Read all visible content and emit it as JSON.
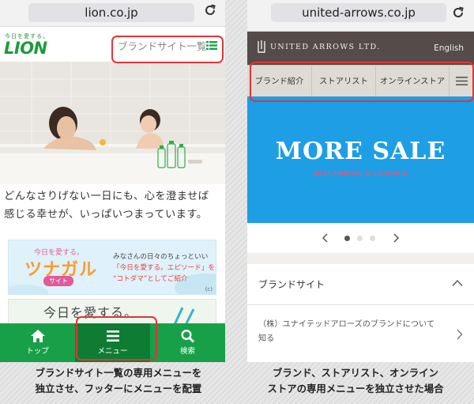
{
  "left": {
    "url": "lion.co.jp",
    "header": {
      "tagline": "今日を愛する。",
      "logo": "LION",
      "brand_menu_label": "ブランドサイト一覧"
    },
    "hero_copy_line1": "どんなさりげない一日にも、心を澄ませば",
    "hero_copy_line2": "感じる幸せが、いっぱいつまっています。",
    "banner1": {
      "small": "今日を愛する。",
      "title": "ツナガル",
      "sub": "サイト",
      "desc_line1": "みなさんの日々のちょっといい",
      "desc_line2": "「今日を愛する。エピソード」を",
      "desc_line3": "“コトダマ”としてご紹介",
      "corner": "(c)"
    },
    "banner2": {
      "text": "今日を愛する。"
    },
    "footer": {
      "top_label": "トップ",
      "menu_label": "メニュー",
      "search_label": "検索"
    },
    "colors": {
      "brand_green": "#18a049",
      "highlight_red": "#e33438"
    }
  },
  "right": {
    "url": "united-arrows.co.jp",
    "header": {
      "logo_text": "UNITED ARROWS LTD.",
      "english": "English"
    },
    "nav": {
      "brand": "ブランド紹介",
      "stores": "ストアリスト",
      "online": "オンラインストア"
    },
    "hero": {
      "title": "MORE SALE",
      "subtitle": "2015 SPRING & SUMMER"
    },
    "carousel": {
      "active_index": 0,
      "count": 3
    },
    "section": {
      "title": "ブランドサイト"
    },
    "list_item": {
      "line1": "（株）ユナイテッドアローズのブランドについて",
      "line2": "知る"
    },
    "colors": {
      "header": "#554b48",
      "hero": "#1d9ee5"
    }
  },
  "captions": {
    "left_line1": "ブランドサイト一覧の専用メニューを",
    "left_line2": "独立させ、フッターにメニューを配置",
    "right_line1": "ブランド、ストアリスト、オンライン",
    "right_line2": "ストアの専用メニューを独立させた場合"
  }
}
